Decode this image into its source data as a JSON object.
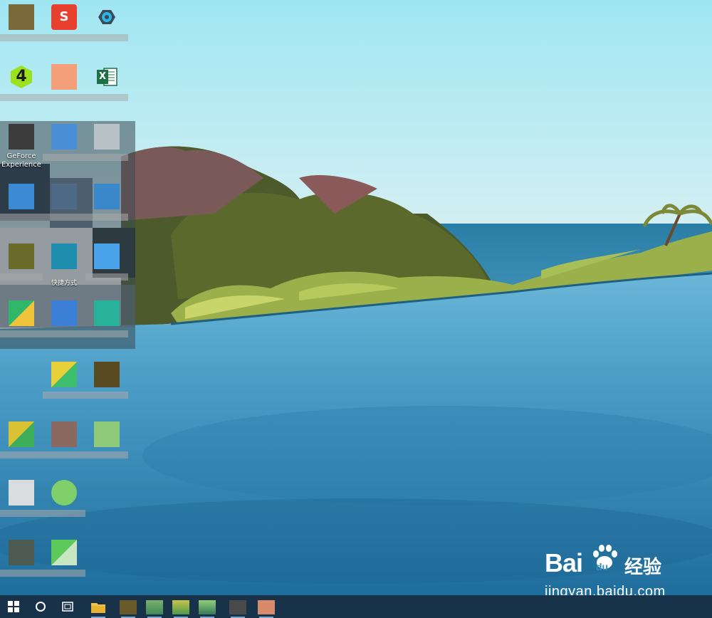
{
  "desktop": {
    "icon_labels": {
      "geforce": "GeForce Experience",
      "excel": "X",
      "number_icon": "4",
      "shortcut_suffix": "快捷方式"
    }
  },
  "watermark": {
    "brand_latin": "Bai",
    "brand_paw": "du",
    "brand_cn": "经验",
    "url": "jingyan.baidu.com"
  },
  "colors": {
    "taskbar": "#18324a",
    "sky_top": "#a9e7f1",
    "sea": "#2b7fa6",
    "pool": "#3a8fb8"
  }
}
